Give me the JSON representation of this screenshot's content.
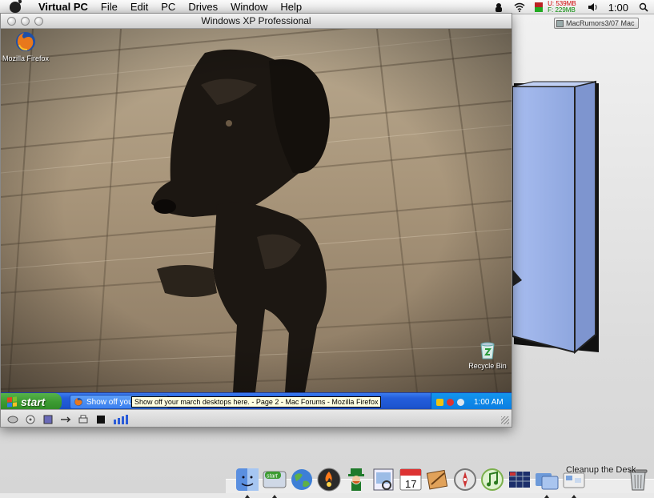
{
  "menubar": {
    "app_name": "Virtual PC",
    "items": [
      "File",
      "Edit",
      "PC",
      "Drives",
      "Window",
      "Help"
    ],
    "memory_used": "U: 539MB",
    "memory_free": "F: 229MB",
    "clock": "1:00"
  },
  "finder_badge": "MacRumors3/07 Mac",
  "vpc_window": {
    "title": "Windows XP Professional"
  },
  "xp_desktop": {
    "icons": [
      {
        "label": "Mozilla Firefox",
        "icon": "firefox-icon"
      },
      {
        "label": "Recycle Bin",
        "icon": "recycle-bin-icon"
      }
    ],
    "tooltip": "Show off your march desktops here. - Page 2 - Mac Forums - Mozilla Firefox",
    "taskbar": {
      "start_label": "start",
      "task_label": "Show off your march ...",
      "clock": "1:00 AM"
    }
  },
  "dock": {
    "hover_label": "Cleanup the Desk",
    "items": [
      "finder-icon",
      "xp-start-icon",
      "globe-icon",
      "firewall-icon",
      "leprechaun-icon",
      "preview-icon",
      "ical-icon",
      "sketch-icon",
      "safari-icon",
      "itunes-icon",
      "spreadsheet-icon",
      "folders-icon",
      "cleanup-desktop-icon",
      "trash-icon"
    ],
    "ical_date": "17"
  },
  "colors": {
    "xp_taskbar": "#245edb",
    "xp_start": "#3c9b32",
    "box_blue": "#9fb6e8"
  }
}
